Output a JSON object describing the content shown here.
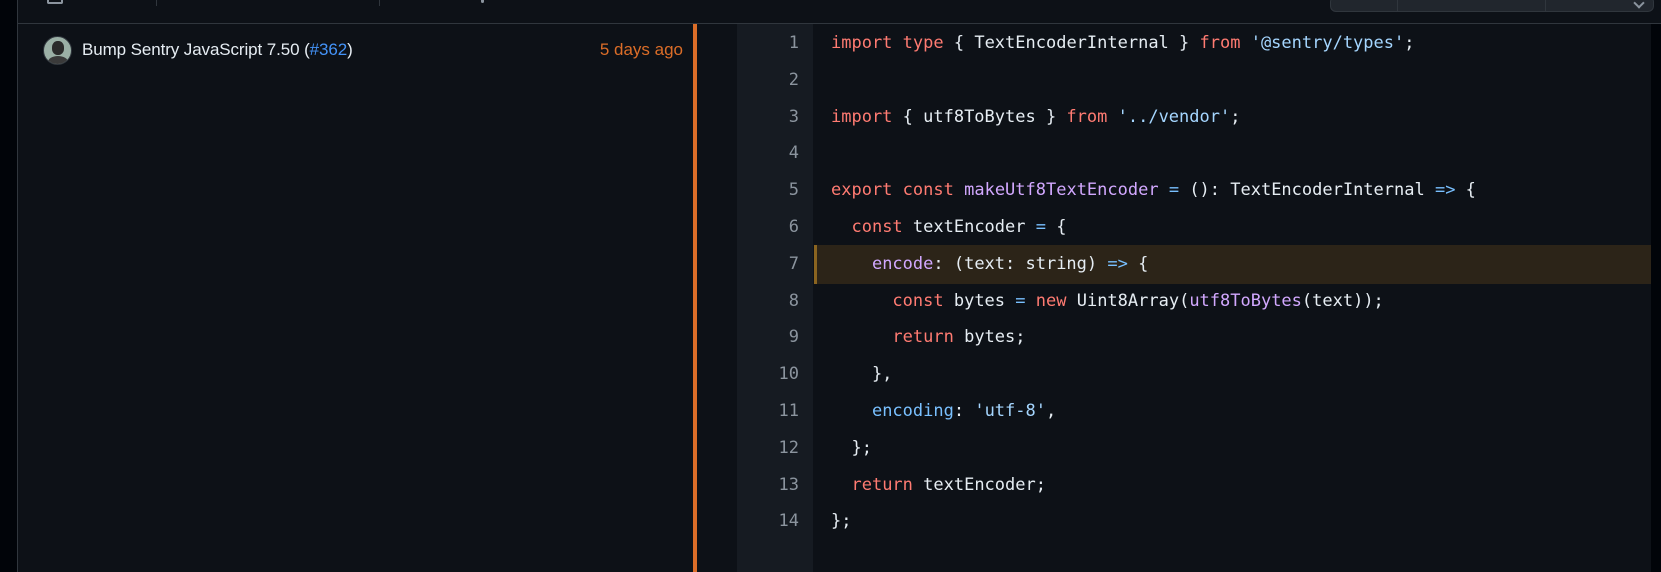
{
  "commit": {
    "message_prefix": "Bump Sentry JavaScript 7.50 (",
    "pr_ref": "#362",
    "message_suffix": ")",
    "time": "5 days ago"
  },
  "colors": {
    "accent_orange": "#db6d28",
    "link_blue": "#4493f8",
    "keyword": "#ff7b72",
    "function": "#d2a8ff",
    "string": "#a5d6ff",
    "property": "#79c0ff"
  },
  "code": {
    "highlighted_line": 7,
    "lines": [
      {
        "n": "1",
        "tokens": [
          [
            "k",
            "import"
          ],
          [
            "t",
            " "
          ],
          [
            "k",
            "type"
          ],
          [
            "t",
            " { TextEncoderInternal } "
          ],
          [
            "k",
            "from"
          ],
          [
            "t",
            " "
          ],
          [
            "s",
            "'@sentry/types'"
          ],
          [
            "t",
            ";"
          ]
        ]
      },
      {
        "n": "2",
        "tokens": []
      },
      {
        "n": "3",
        "tokens": [
          [
            "k",
            "import"
          ],
          [
            "t",
            " { utf8ToBytes } "
          ],
          [
            "k",
            "from"
          ],
          [
            "t",
            " "
          ],
          [
            "s",
            "'../vendor'"
          ],
          [
            "t",
            ";"
          ]
        ]
      },
      {
        "n": "4",
        "tokens": []
      },
      {
        "n": "5",
        "tokens": [
          [
            "k",
            "export"
          ],
          [
            "t",
            " "
          ],
          [
            "k",
            "const"
          ],
          [
            "t",
            " "
          ],
          [
            "f",
            "makeUtf8TextEncoder"
          ],
          [
            "t",
            " "
          ],
          [
            "p",
            "="
          ],
          [
            "t",
            " (): TextEncoderInternal "
          ],
          [
            "p",
            "=>"
          ],
          [
            "t",
            " {"
          ]
        ]
      },
      {
        "n": "6",
        "tokens": [
          [
            "t",
            "  "
          ],
          [
            "k",
            "const"
          ],
          [
            "t",
            " textEncoder "
          ],
          [
            "p",
            "="
          ],
          [
            "t",
            " {"
          ]
        ]
      },
      {
        "n": "7",
        "tokens": [
          [
            "t",
            "    "
          ],
          [
            "f",
            "encode"
          ],
          [
            "t",
            ": (text: string) "
          ],
          [
            "p",
            "=>"
          ],
          [
            "t",
            " {"
          ]
        ]
      },
      {
        "n": "8",
        "tokens": [
          [
            "t",
            "      "
          ],
          [
            "k",
            "const"
          ],
          [
            "t",
            " bytes "
          ],
          [
            "p",
            "="
          ],
          [
            "t",
            " "
          ],
          [
            "k",
            "new"
          ],
          [
            "t",
            " Uint8Array("
          ],
          [
            "f",
            "utf8ToBytes"
          ],
          [
            "t",
            "(text));"
          ]
        ]
      },
      {
        "n": "9",
        "tokens": [
          [
            "t",
            "      "
          ],
          [
            "k",
            "return"
          ],
          [
            "t",
            " bytes;"
          ]
        ]
      },
      {
        "n": "10",
        "tokens": [
          [
            "t",
            "    },"
          ]
        ]
      },
      {
        "n": "11",
        "tokens": [
          [
            "t",
            "    "
          ],
          [
            "p",
            "encoding"
          ],
          [
            "t",
            ": "
          ],
          [
            "s",
            "'utf-8'"
          ],
          [
            "t",
            ","
          ]
        ]
      },
      {
        "n": "12",
        "tokens": [
          [
            "t",
            "  };"
          ]
        ]
      },
      {
        "n": "13",
        "tokens": [
          [
            "t",
            "  "
          ],
          [
            "k",
            "return"
          ],
          [
            "t",
            " textEncoder;"
          ]
        ]
      },
      {
        "n": "14",
        "tokens": [
          [
            "t",
            "};"
          ]
        ]
      }
    ]
  }
}
